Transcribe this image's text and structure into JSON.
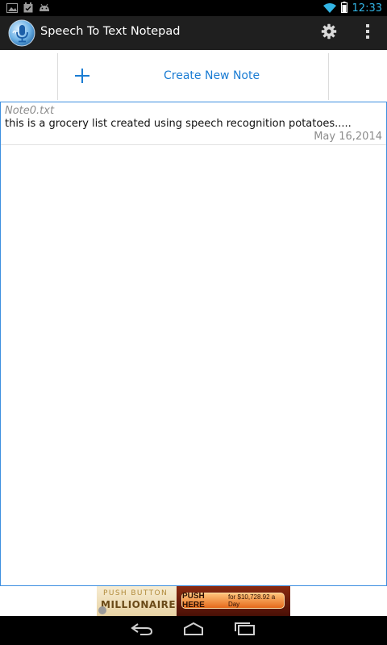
{
  "status_bar": {
    "time": "12:33",
    "icons": [
      "image-icon",
      "calendar-icon",
      "android-icon",
      "wifi-icon",
      "battery-icon"
    ]
  },
  "app": {
    "title": "Speech To Text Notepad",
    "icon": "microphone-icon",
    "actions": [
      "settings-icon",
      "overflow-menu-icon"
    ]
  },
  "create_note": {
    "label": "Create New Note",
    "icon": "plus-icon"
  },
  "notes": [
    {
      "filename": "Note0.txt",
      "preview": "this is a grocery list created using speech recognition potatoes.....",
      "date": "May 16,2014"
    }
  ],
  "ad": {
    "line1": "PUSH BUTTON",
    "line2": "MILLIONAIRE",
    "button_main": "PUSH HERE",
    "button_sub": "for $10,728.92 a Day"
  },
  "colors": {
    "accent": "#33b5e5",
    "link_blue": "#1a7cd3",
    "action_bar": "#1f1f1f",
    "list_border": "#3d8fe0"
  }
}
